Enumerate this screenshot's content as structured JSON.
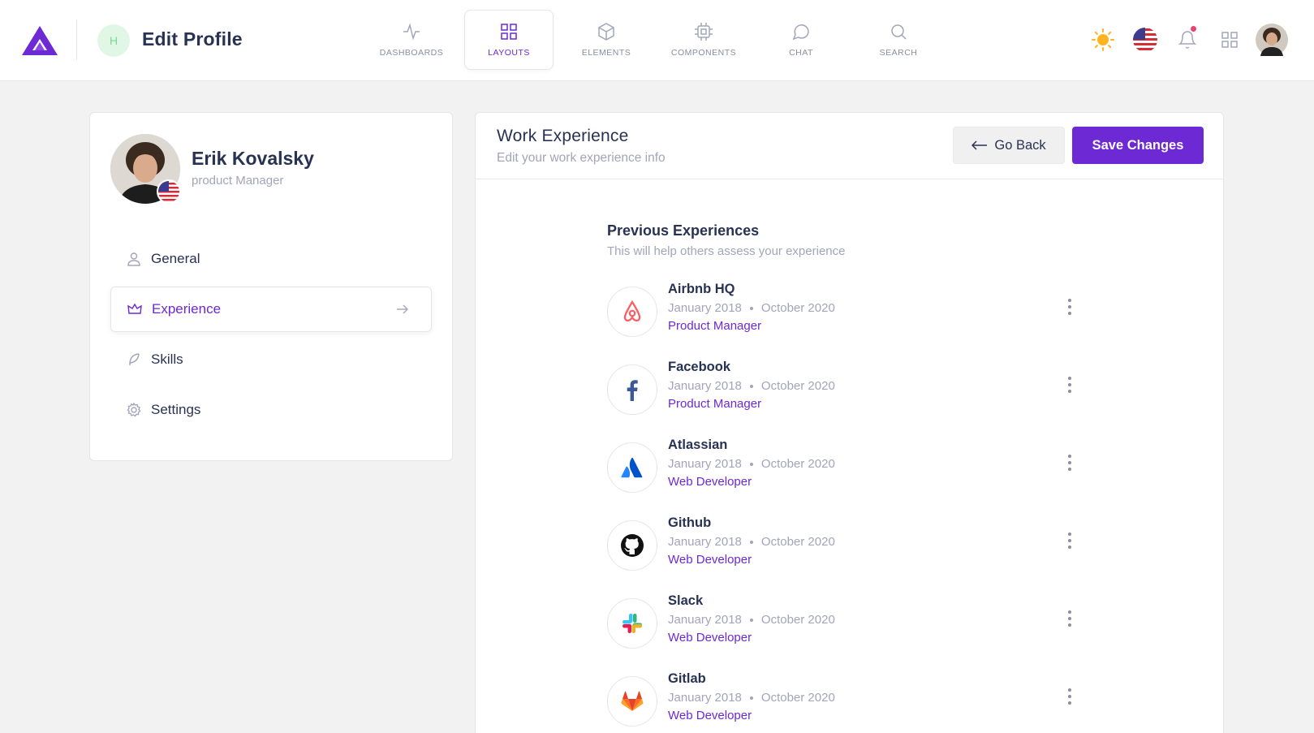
{
  "header": {
    "page_avatar_initial": "H",
    "page_title": "Edit Profile",
    "nav_tabs": [
      {
        "label": "DASHBOARDS",
        "icon": "activity-icon"
      },
      {
        "label": "LAYOUTS",
        "icon": "grid-icon",
        "active": true
      },
      {
        "label": "ELEMENTS",
        "icon": "box-icon"
      },
      {
        "label": "COMPONENTS",
        "icon": "cpu-icon"
      },
      {
        "label": "CHAT",
        "icon": "message-circle-icon"
      },
      {
        "label": "SEARCH",
        "icon": "search-icon"
      }
    ],
    "right_icons": [
      "sun-icon",
      "us-flag-icon",
      "bell-icon",
      "apps-grid-icon",
      "user-avatar"
    ]
  },
  "profile": {
    "name": "Erik Kovalsky",
    "role": "product Manager",
    "menu": [
      {
        "label": "General",
        "icon": "user-icon"
      },
      {
        "label": "Experience",
        "icon": "crown-icon",
        "active": true
      },
      {
        "label": "Skills",
        "icon": "feather-icon"
      },
      {
        "label": "Settings",
        "icon": "settings-icon"
      }
    ]
  },
  "main": {
    "title": "Work Experience",
    "subtitle": "Edit your work experience info",
    "back_label": "Go Back",
    "save_label": "Save Changes",
    "section_title": "Previous Experiences",
    "section_subtitle": "This will help others assess your experience",
    "experiences": [
      {
        "company": "Airbnb HQ",
        "start": "January 2018",
        "end": "October 2020",
        "role": "Product Manager",
        "logo": "airbnb-logo"
      },
      {
        "company": "Facebook",
        "start": "January 2018",
        "end": "October 2020",
        "role": "Product Manager",
        "logo": "facebook-logo"
      },
      {
        "company": "Atlassian",
        "start": "January 2018",
        "end": "October 2020",
        "role": "Web Developer",
        "logo": "atlassian-logo"
      },
      {
        "company": "Github",
        "start": "January 2018",
        "end": "October 2020",
        "role": "Web Developer",
        "logo": "github-logo"
      },
      {
        "company": "Slack",
        "start": "January 2018",
        "end": "October 2020",
        "role": "Web Developer",
        "logo": "slack-logo"
      },
      {
        "company": "Gitlab",
        "start": "January 2018",
        "end": "October 2020",
        "role": "Web Developer",
        "logo": "gitlab-logo"
      }
    ]
  },
  "colors": {
    "primary": "#6c29d4",
    "text": "#283252",
    "muted": "#a2a5b9",
    "background": "#f2f2f2"
  }
}
